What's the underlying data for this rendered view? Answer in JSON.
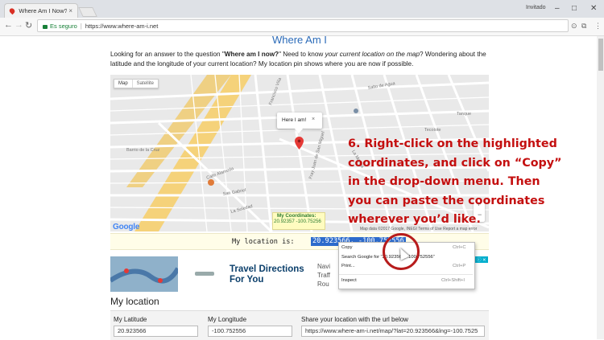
{
  "browser": {
    "tab_title": "Where Am I Now? What",
    "tab_close": "×",
    "user": "Invitado",
    "win_min": "–",
    "win_max": "□",
    "win_close": "✕",
    "back": "←",
    "forward": "→",
    "reload": "↻",
    "secure_label": "Es seguro",
    "url": "https://www.where-am-i.net",
    "menu": "⋮"
  },
  "page": {
    "title": "Where Am I",
    "intro_1": "Looking for an answer to the question \"",
    "intro_bold": "Where am I now?",
    "intro_2": "\" Need to know ",
    "intro_italic": "your current location on the map",
    "intro_3": "? Wondering about the latitude and the longitude of your current location? My location pin shows where you are now if possible."
  },
  "map": {
    "type_map": "Map",
    "type_satellite": "Satellite",
    "info_window": "Here I am!",
    "info_close": "×",
    "coords_title": "My Coordinates:",
    "coords_value": "20.92357 -100.75256",
    "google": "Google",
    "footer": "Map data ©2017 Google, INEGI   Terms of Use   Report a map error",
    "zoom_in": "+",
    "zoom_out": "−",
    "streets": [
      "Francisco Villa",
      "La Manga",
      "Salto de Agua",
      "San Gabriel",
      "La Soledad",
      "Calle Alameda",
      "Barrio de la Cruz",
      "Fray Juan de San Miguel",
      "Tecolote",
      "Tanque"
    ]
  },
  "overlay": {
    "line1": "6. Right-click on the highlighted",
    "line2": "coordinates, and click on “Copy”",
    "line3": "in the drop-down menu. Then",
    "line4": "you can paste the coordinates",
    "line5": "wherever you’d like."
  },
  "location": {
    "label": "My location is:",
    "selected": "20.923566, -100.752556"
  },
  "context_menu": {
    "copy": "Copy",
    "copy_shortcut": "Ctrl+C",
    "search": "Search Google for “20.923566, -100.752556”",
    "print": "Print...",
    "print_shortcut": "Ctrl+P",
    "inspect": "Inspect",
    "inspect_shortcut": "Ctrl+Shift+I"
  },
  "ad": {
    "title": "Travel Directions For You",
    "side": "Navi\nTraff\nRou",
    "badge": "ⓘ ✕"
  },
  "section": {
    "heading": "My location",
    "lat_label": "My Latitude",
    "lon_label": "My Longitude",
    "share_label": "Share your location with the url below",
    "lat_value": "20.923566",
    "lon_value": "-100.752556",
    "share_value": "https://www.where-am-i.net/map/?lat=20.923566&lng=-100.7525"
  }
}
